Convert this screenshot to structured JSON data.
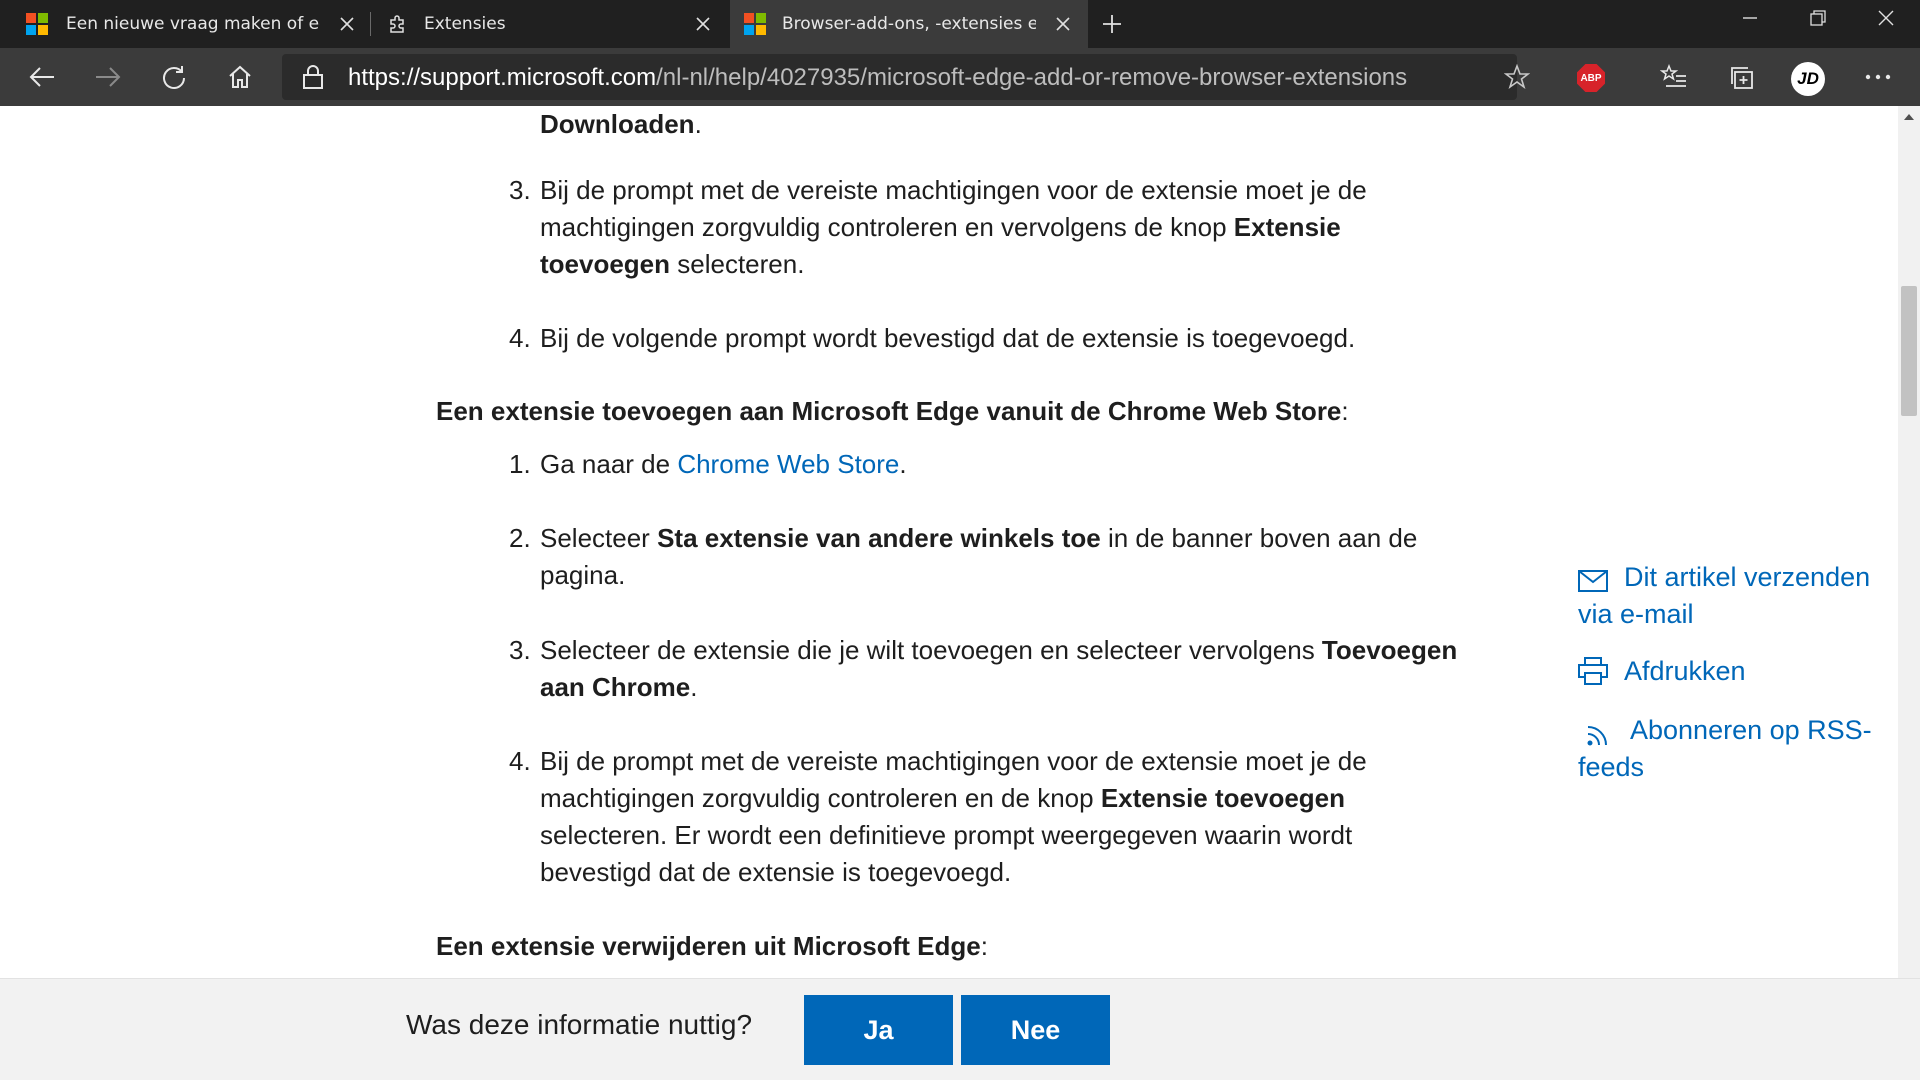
{
  "browser": {
    "tabs": [
      {
        "title": "Een nieuwe vraag maken of een",
        "icon": "microsoft-logo"
      },
      {
        "title": "Extensies",
        "icon": "puzzle-icon"
      },
      {
        "title": "Browser-add-ons, -extensies en",
        "icon": "microsoft-logo",
        "active": true
      }
    ],
    "url_host": "https://support.microsoft.com",
    "url_path": "/nl-nl/help/4027935/microsoft-edge-add-or-remove-browser-extensions",
    "abp_label": "ABP",
    "profile_initials": "JD"
  },
  "article": {
    "step2_tail": "Downloaden",
    "step2_tail_end": ".",
    "store_steps": [
      {
        "num": "3.",
        "l1": "Bij de prompt met de vereiste machtigingen voor de extensie moet je de",
        "l2a": "machtigingen zorgvuldig controleren en vervolgens de knop ",
        "l2b": "Extensie",
        "l3a": "toevoegen",
        "l3b": " selecteren."
      },
      {
        "num": "4.",
        "l1": "Bij de volgende prompt wordt bevestigd dat de extensie is toegevoegd."
      }
    ],
    "chrome_heading": "Een extensie toevoegen aan Microsoft Edge vanuit de Chrome Web Store",
    "chrome_heading_colon": ":",
    "chrome_steps": [
      {
        "num": "1.",
        "a": "Ga naar de ",
        "link": "Chrome Web Store",
        "b": "."
      },
      {
        "num": "2.",
        "a": "Selecteer ",
        "bold": "Sta extensie van andere winkels toe",
        "b": " in de banner boven aan de",
        "l2": "pagina."
      },
      {
        "num": "3.",
        "a": "Selecteer de extensie die je wilt toevoegen en selecteer vervolgens ",
        "bold": "Toevoegen",
        "l2bold": "aan Chrome",
        "l2end": "."
      },
      {
        "num": "4.",
        "l1": "Bij de prompt met de vereiste machtigingen voor de extensie moet je de",
        "l2a": "machtigingen zorgvuldig controleren en de knop ",
        "l2bold": "Extensie toevoegen",
        "l3": "selecteren. Er wordt een definitieve prompt weergegeven waarin wordt",
        "l4": "bevestigd dat de extensie is toegevoegd."
      }
    ],
    "remove_heading": "Een extensie verwijderen uit Microsoft Edge",
    "remove_heading_colon": ":"
  },
  "sidebar": {
    "email_l1": "Dit artikel verzenden",
    "email_l2": "via e-mail",
    "print": "Afdrukken",
    "rss_l1": "Abonneren op RSS-",
    "rss_l2": "feeds"
  },
  "feedback": {
    "question": "Was deze informatie nuttig?",
    "yes": "Ja",
    "no": "Nee"
  },
  "colors": {
    "link": "#0067b8",
    "button": "#0067b8",
    "tabbar": "#202020",
    "toolbar": "#3b3b3b"
  }
}
